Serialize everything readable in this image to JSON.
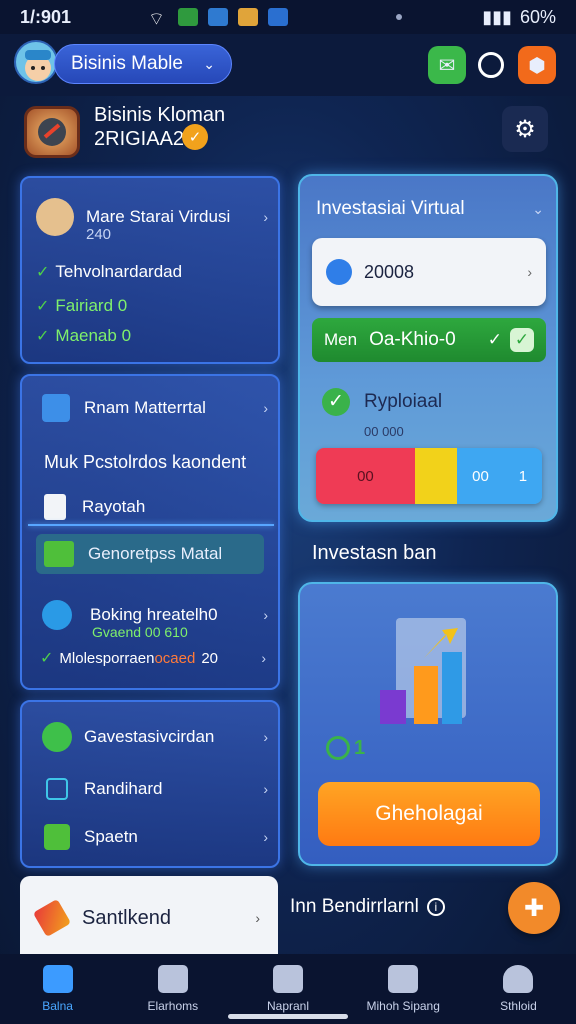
{
  "status_bar": {
    "time": "1/:901",
    "battery": "60%"
  },
  "header": {
    "dropdown_label": "Bisinis Mable"
  },
  "profile": {
    "name": "Bisinis Kloman",
    "id": "2RIGIAA21"
  },
  "card_1": {
    "title": "Mare Starai Virdusi",
    "subtitle": "240",
    "items": [
      "Tehvolnardardad",
      "Fairiard 0",
      "Maenab 0"
    ]
  },
  "card_2": {
    "title": "Rnam Matterrtal",
    "subtitle": "Muk Pcstolrdos kaondent",
    "item_1": "Rayotah",
    "highlight": "Genoretpss Matal",
    "booking_title": "Boking hreatelh0",
    "booking_sub": "Gvaend 00 610",
    "booking_status_1": "Mlolesporraen",
    "booking_status_2": "ocaed",
    "booking_status_3": "20"
  },
  "card_3": {
    "items": [
      "Gavestasivcirdan",
      "Randihard",
      "Spaetn"
    ]
  },
  "right_panel": {
    "title": "Investasiai Virtual",
    "field_value": "20008",
    "green_label": "Men",
    "green_value": "Oa-Khio-0",
    "status_title": "Ryploiaal",
    "status_sub": "00 000",
    "bar_text_1": "00",
    "bar_text_2": "00",
    "bar_text_3": "1",
    "bar_colors": [
      "#ef3b55",
      "#f2d21a",
      "#3ea7f2"
    ]
  },
  "investasi_section": {
    "heading": "Investasn ban",
    "stat": "1",
    "button": "Gheholagai"
  },
  "bottom_card": {
    "label": "Santlkend",
    "side_text": "Inn Bendirrlarnl"
  },
  "bottom_nav": [
    "Balna",
    "Elarhoms",
    "Napranl",
    "Mihoh Sipang",
    "Sthloid"
  ],
  "colors": {
    "accent": "#3b74e6",
    "orange": "#ff8a1c",
    "green": "#2ea83e"
  }
}
